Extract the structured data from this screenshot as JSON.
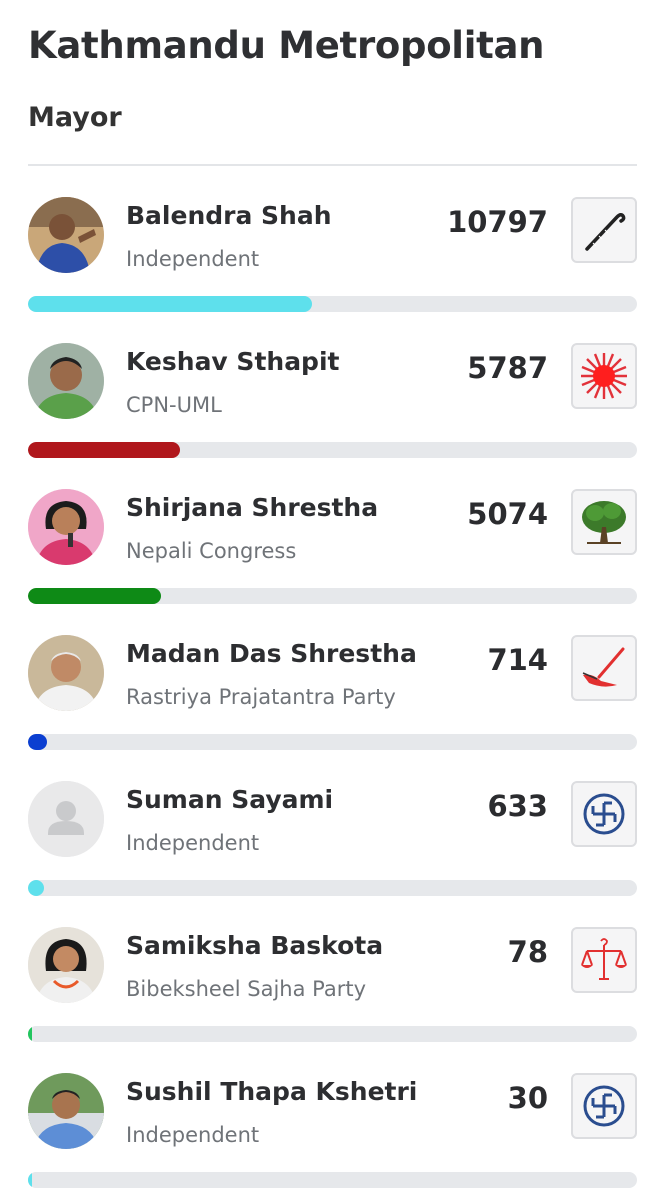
{
  "header": {
    "title": "Kathmandu Metropolitan",
    "subtitle": "Mayor"
  },
  "candidates": [
    {
      "name": "Balendra Shah",
      "party": "Independent",
      "votes": "10797",
      "share": 0.467,
      "bar_color": "#5ee0ec",
      "symbol_icon": "walking-stick-icon",
      "avatar": "photo"
    },
    {
      "name": "Keshav Sthapit",
      "party": "CPN-UML",
      "votes": "5787",
      "share": 0.25,
      "bar_color": "#b0171c",
      "symbol_icon": "sun-icon",
      "avatar": "photo"
    },
    {
      "name": "Shirjana Shrestha",
      "party": "Nepali Congress",
      "votes": "5074",
      "share": 0.219,
      "bar_color": "#0e8a16",
      "symbol_icon": "tree-icon",
      "avatar": "photo"
    },
    {
      "name": "Madan Das Shrestha",
      "party": "Rastriya Prajatantra Party",
      "votes": "714",
      "share": 0.031,
      "bar_color": "#0b3fd1",
      "symbol_icon": "plough-icon",
      "avatar": "photo"
    },
    {
      "name": "Suman Sayami",
      "party": "Independent",
      "votes": "633",
      "share": 0.027,
      "bar_color": "#5ee0ec",
      "symbol_icon": "swastika-icon",
      "avatar": "placeholder"
    },
    {
      "name": "Samiksha Baskota",
      "party": "Bibeksheel Sajha Party",
      "votes": "78",
      "share": 0.0034,
      "bar_color": "#22c55e",
      "symbol_icon": "scales-icon",
      "avatar": "photo"
    },
    {
      "name": "Sushil Thapa Kshetri",
      "party": "Independent",
      "votes": "30",
      "share": 0.0013,
      "bar_color": "#5ee0ec",
      "symbol_icon": "swastika-icon",
      "avatar": "photo"
    }
  ]
}
